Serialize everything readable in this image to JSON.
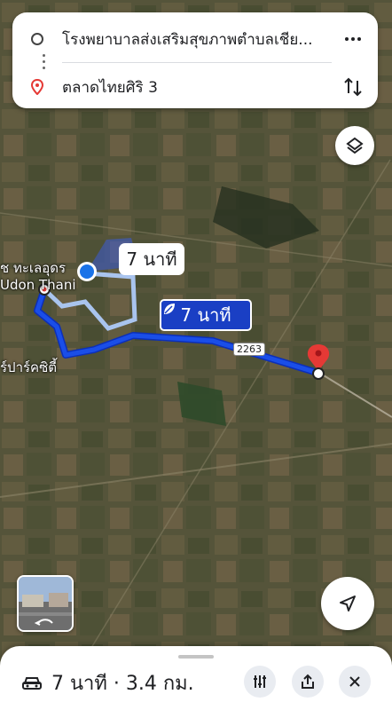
{
  "search": {
    "origin": "โรงพยาบาลส่งเสริมสุขภาพตำบลเชีย...",
    "destination": "ตลาดไทยศิริ 3"
  },
  "map": {
    "route_bubble_alt": "7 นาที",
    "route_bubble_main": "7 นาที",
    "road_number": "2263",
    "place_label_1a": "ช ทะเลอุดร",
    "place_label_1b": "Udon Thani",
    "place_label_2": "ร์ปาร์คซิตี้",
    "route_color": "#1a3fc4",
    "alt_route_color": "#a9c4ee",
    "destination_pin_color": "#e53935"
  },
  "bottom": {
    "summary": "7 นาที · 3.4 กม.",
    "icons": [
      "car-icon",
      "tune-icon",
      "share-icon",
      "close-icon"
    ]
  }
}
